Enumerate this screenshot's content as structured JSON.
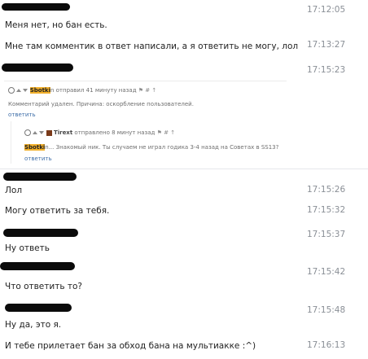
{
  "messages": [
    {
      "time": "17:12:05",
      "text": "Меня нет, но бан есть."
    },
    {
      "time": "17:13:27",
      "text": "Мне там комментик в ответ написали, а я ответить не могу, лол"
    },
    {
      "time": "17:15:23",
      "text": ""
    },
    {
      "time": "17:15:26",
      "text": "Лол"
    },
    {
      "time": "17:15:32",
      "text": "Могу ответить за тебя."
    },
    {
      "time": "17:15:37",
      "text": "Ну ответь"
    },
    {
      "time": "17:15:42",
      "text": "Что ответить то?"
    },
    {
      "time": "17:15:48",
      "text": "Ну да, это я."
    },
    {
      "time": "17:16:13",
      "text": "И тебе прилетает бан за обход бана на мультиакке :^)"
    }
  ],
  "embed": {
    "comment1": {
      "user": "Sbotki",
      "user_suffix": "n",
      "meta": "отправил 41 минуту назад",
      "text": "Комментарий удален. Причина: оскорбление пользователей.",
      "reply_label": "ответить"
    },
    "comment2": {
      "user": "Tirext",
      "meta": "отправлено 8 минут назад",
      "mention": "Sbotki",
      "text": "n... Знакомый ник. Ты случаем не играл годика 3-4 назад на Советах в SS13?",
      "reply_label": "ответить"
    }
  },
  "icons": {
    "vote_up": "arrow-up-icon",
    "vote_down": "arrow-down-icon",
    "clock": "clock-icon",
    "flag": "flag-icon",
    "link": "link-icon"
  },
  "colors": {
    "timestamp": "#8a8f96",
    "highlight": "#f2b02b",
    "link": "#3e6ea8",
    "redaction": "#0b0b0b"
  }
}
